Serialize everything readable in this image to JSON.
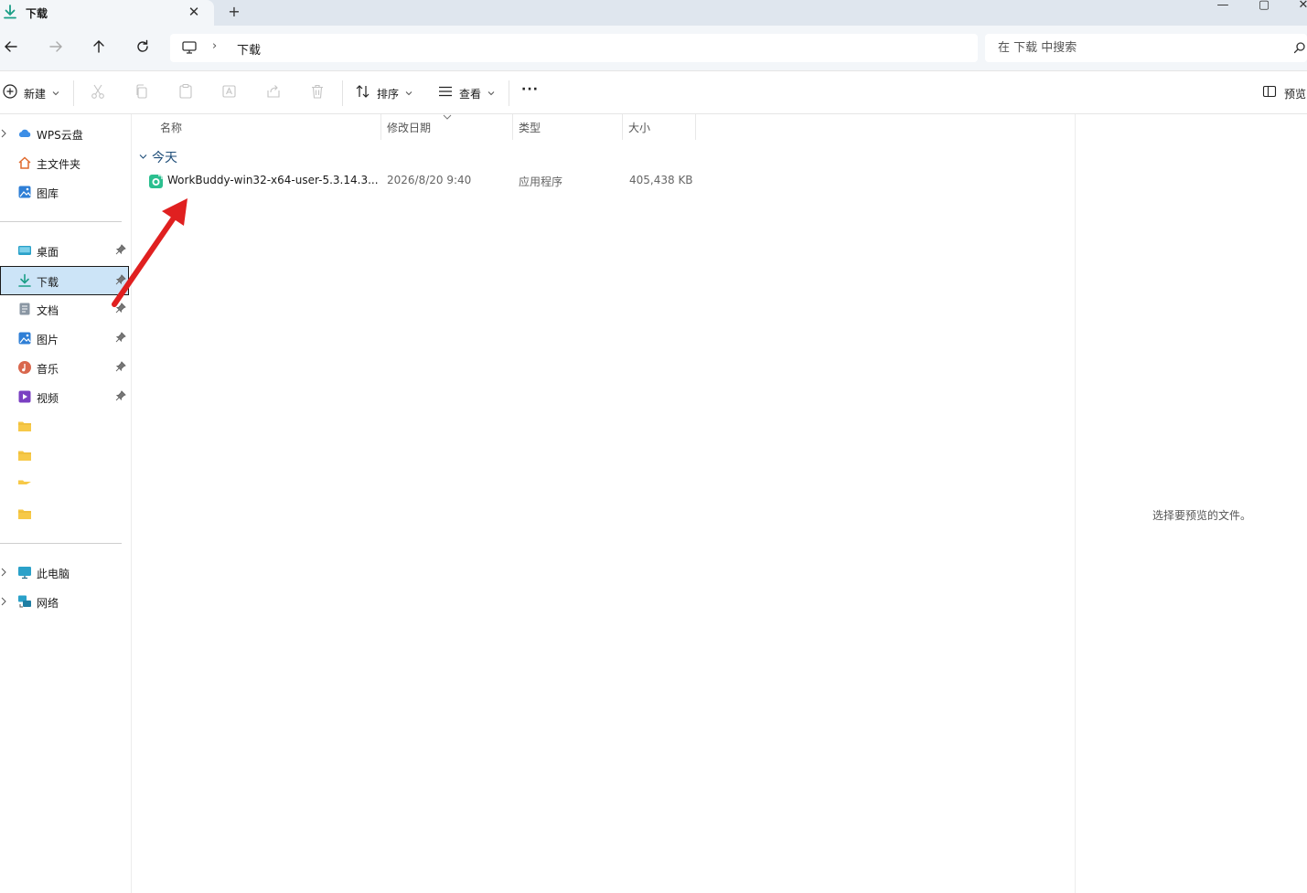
{
  "window": {
    "tab_title": "下载",
    "close_tab_glyph": "✕",
    "new_tab_glyph": "+",
    "minimize_glyph": "—",
    "maximize_glyph": "▢",
    "close_glyph": "✕"
  },
  "address": {
    "separator": "›",
    "breadcrumb": [
      "下载"
    ],
    "search_placeholder": "在 下载 中搜索"
  },
  "commands": {
    "new_label": "新建",
    "sort_label": "排序",
    "view_label": "查看",
    "more_glyph": "···",
    "preview_label": "预览"
  },
  "sidebar": {
    "top_items": [
      {
        "label": "WPS云盘",
        "icon": "cloud-icon",
        "expandable": true
      },
      {
        "label": "主文件夹",
        "icon": "home-icon"
      },
      {
        "label": "图库",
        "icon": "gallery-icon"
      }
    ],
    "quick_access": [
      {
        "label": "桌面",
        "icon": "desktop-icon",
        "pinned": true
      },
      {
        "label": "下载",
        "icon": "download-icon",
        "pinned": true,
        "selected": true
      },
      {
        "label": "文档",
        "icon": "document-icon",
        "pinned": true
      },
      {
        "label": "图片",
        "icon": "pictures-icon",
        "pinned": true
      },
      {
        "label": "音乐",
        "icon": "music-icon",
        "pinned": true
      },
      {
        "label": "视频",
        "icon": "video-icon",
        "pinned": true
      },
      {
        "label": "",
        "icon": "folder-icon"
      },
      {
        "label": "",
        "icon": "folder-icon"
      },
      {
        "label": "",
        "icon": "folder-icon"
      },
      {
        "label": "",
        "icon": "folder-icon"
      }
    ],
    "bottom_items": [
      {
        "label": "此电脑",
        "icon": "this-pc-icon",
        "expandable": true
      },
      {
        "label": "网络",
        "icon": "network-icon",
        "expandable": true
      }
    ]
  },
  "file_list": {
    "columns": [
      "名称",
      "修改日期",
      "类型",
      "大小"
    ],
    "sorted_column": "修改日期",
    "groups": [
      {
        "label": "今天",
        "rows": [
          {
            "name": "WorkBuddy-win32-x64-user-5.3.14.3...",
            "modified": "2026/8/20 9:40",
            "type": "应用程序",
            "size": "405,438 KB",
            "icon": "app-installer-icon"
          }
        ]
      }
    ]
  },
  "preview": {
    "empty_message": "选择要预览的文件。"
  },
  "colors": {
    "accent": "#0078d4",
    "selected_bg": "#cce4f7",
    "titlebar_bg": "#dfe6ee",
    "annotation_arrow": "#e02020"
  }
}
